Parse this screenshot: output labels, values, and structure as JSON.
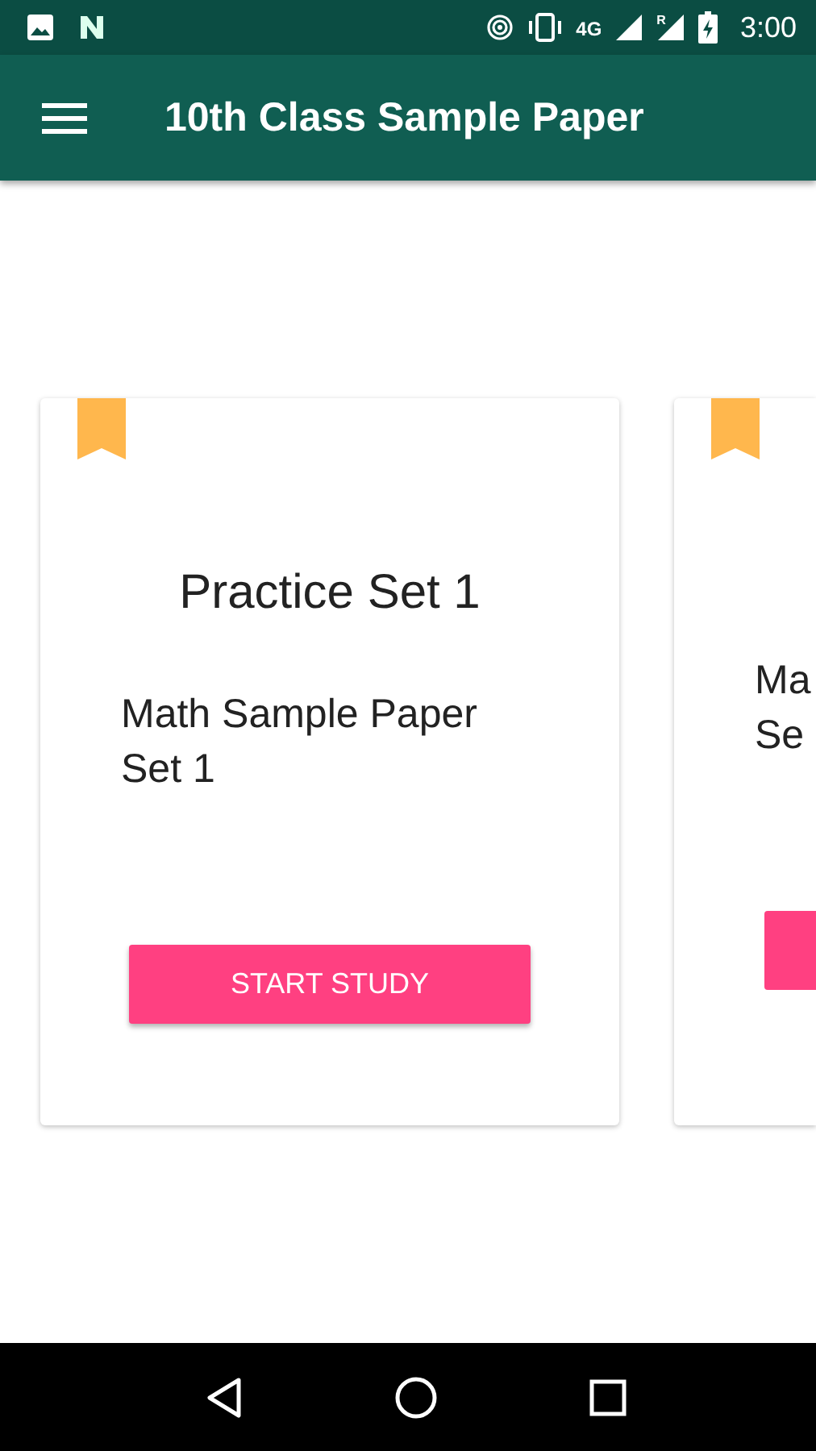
{
  "status_bar": {
    "network": "4G",
    "roaming": "R",
    "time": "3:00"
  },
  "app_bar": {
    "title": "10th Class Sample Paper"
  },
  "cards": [
    {
      "kind": "full",
      "bookmarked": true,
      "title": "Practice Set 1",
      "body": "Math Sample Paper Set 1",
      "button": "START STUDY"
    },
    {
      "kind": "partial",
      "bookmarked": true,
      "body_lines": [
        "Ma",
        "Se"
      ]
    }
  ]
}
